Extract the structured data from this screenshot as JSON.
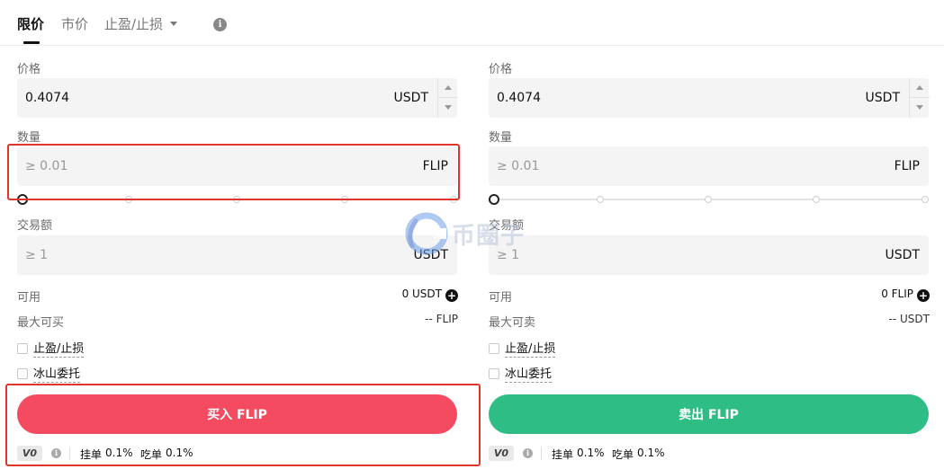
{
  "tabs": {
    "limit": "限价",
    "market": "市价",
    "tp_sl": "止盈/止损"
  },
  "buy": {
    "price_label": "价格",
    "price_value": "0.4074",
    "price_unit": "USDT",
    "amount_label": "数量",
    "amount_placeholder": "≥ 0.01",
    "amount_unit": "FLIP",
    "total_label": "交易额",
    "total_placeholder": "≥ 1",
    "total_unit": "USDT",
    "available_label": "可用",
    "available_value": "0 USDT",
    "max_label": "最大可买",
    "max_value": "-- FLIP",
    "tp_sl_label": "止盈/止损",
    "iceberg_label": "冰山委托",
    "button_label": "买入 FLIP",
    "slider_percent": 0
  },
  "sell": {
    "price_label": "价格",
    "price_value": "0.4074",
    "price_unit": "USDT",
    "amount_label": "数量",
    "amount_placeholder": "≥ 0.01",
    "amount_unit": "FLIP",
    "total_label": "交易额",
    "total_placeholder": "≥ 1",
    "total_unit": "USDT",
    "available_label": "可用",
    "available_value": "0 FLIP",
    "max_label": "最大可卖",
    "max_value": "-- USDT",
    "tp_sl_label": "止盈/止损",
    "iceberg_label": "冰山委托",
    "button_label": "卖出 FLIP",
    "slider_percent": 0
  },
  "fees": {
    "vip_level": "V0",
    "maker_label": "挂单",
    "maker_value": "0.1%",
    "taker_label": "吃单",
    "taker_value": "0.1%"
  },
  "watermark": {
    "text": "币圈子"
  },
  "colors": {
    "buy": "#f54b60",
    "sell": "#2ebd85",
    "highlight": "#e0352b"
  }
}
